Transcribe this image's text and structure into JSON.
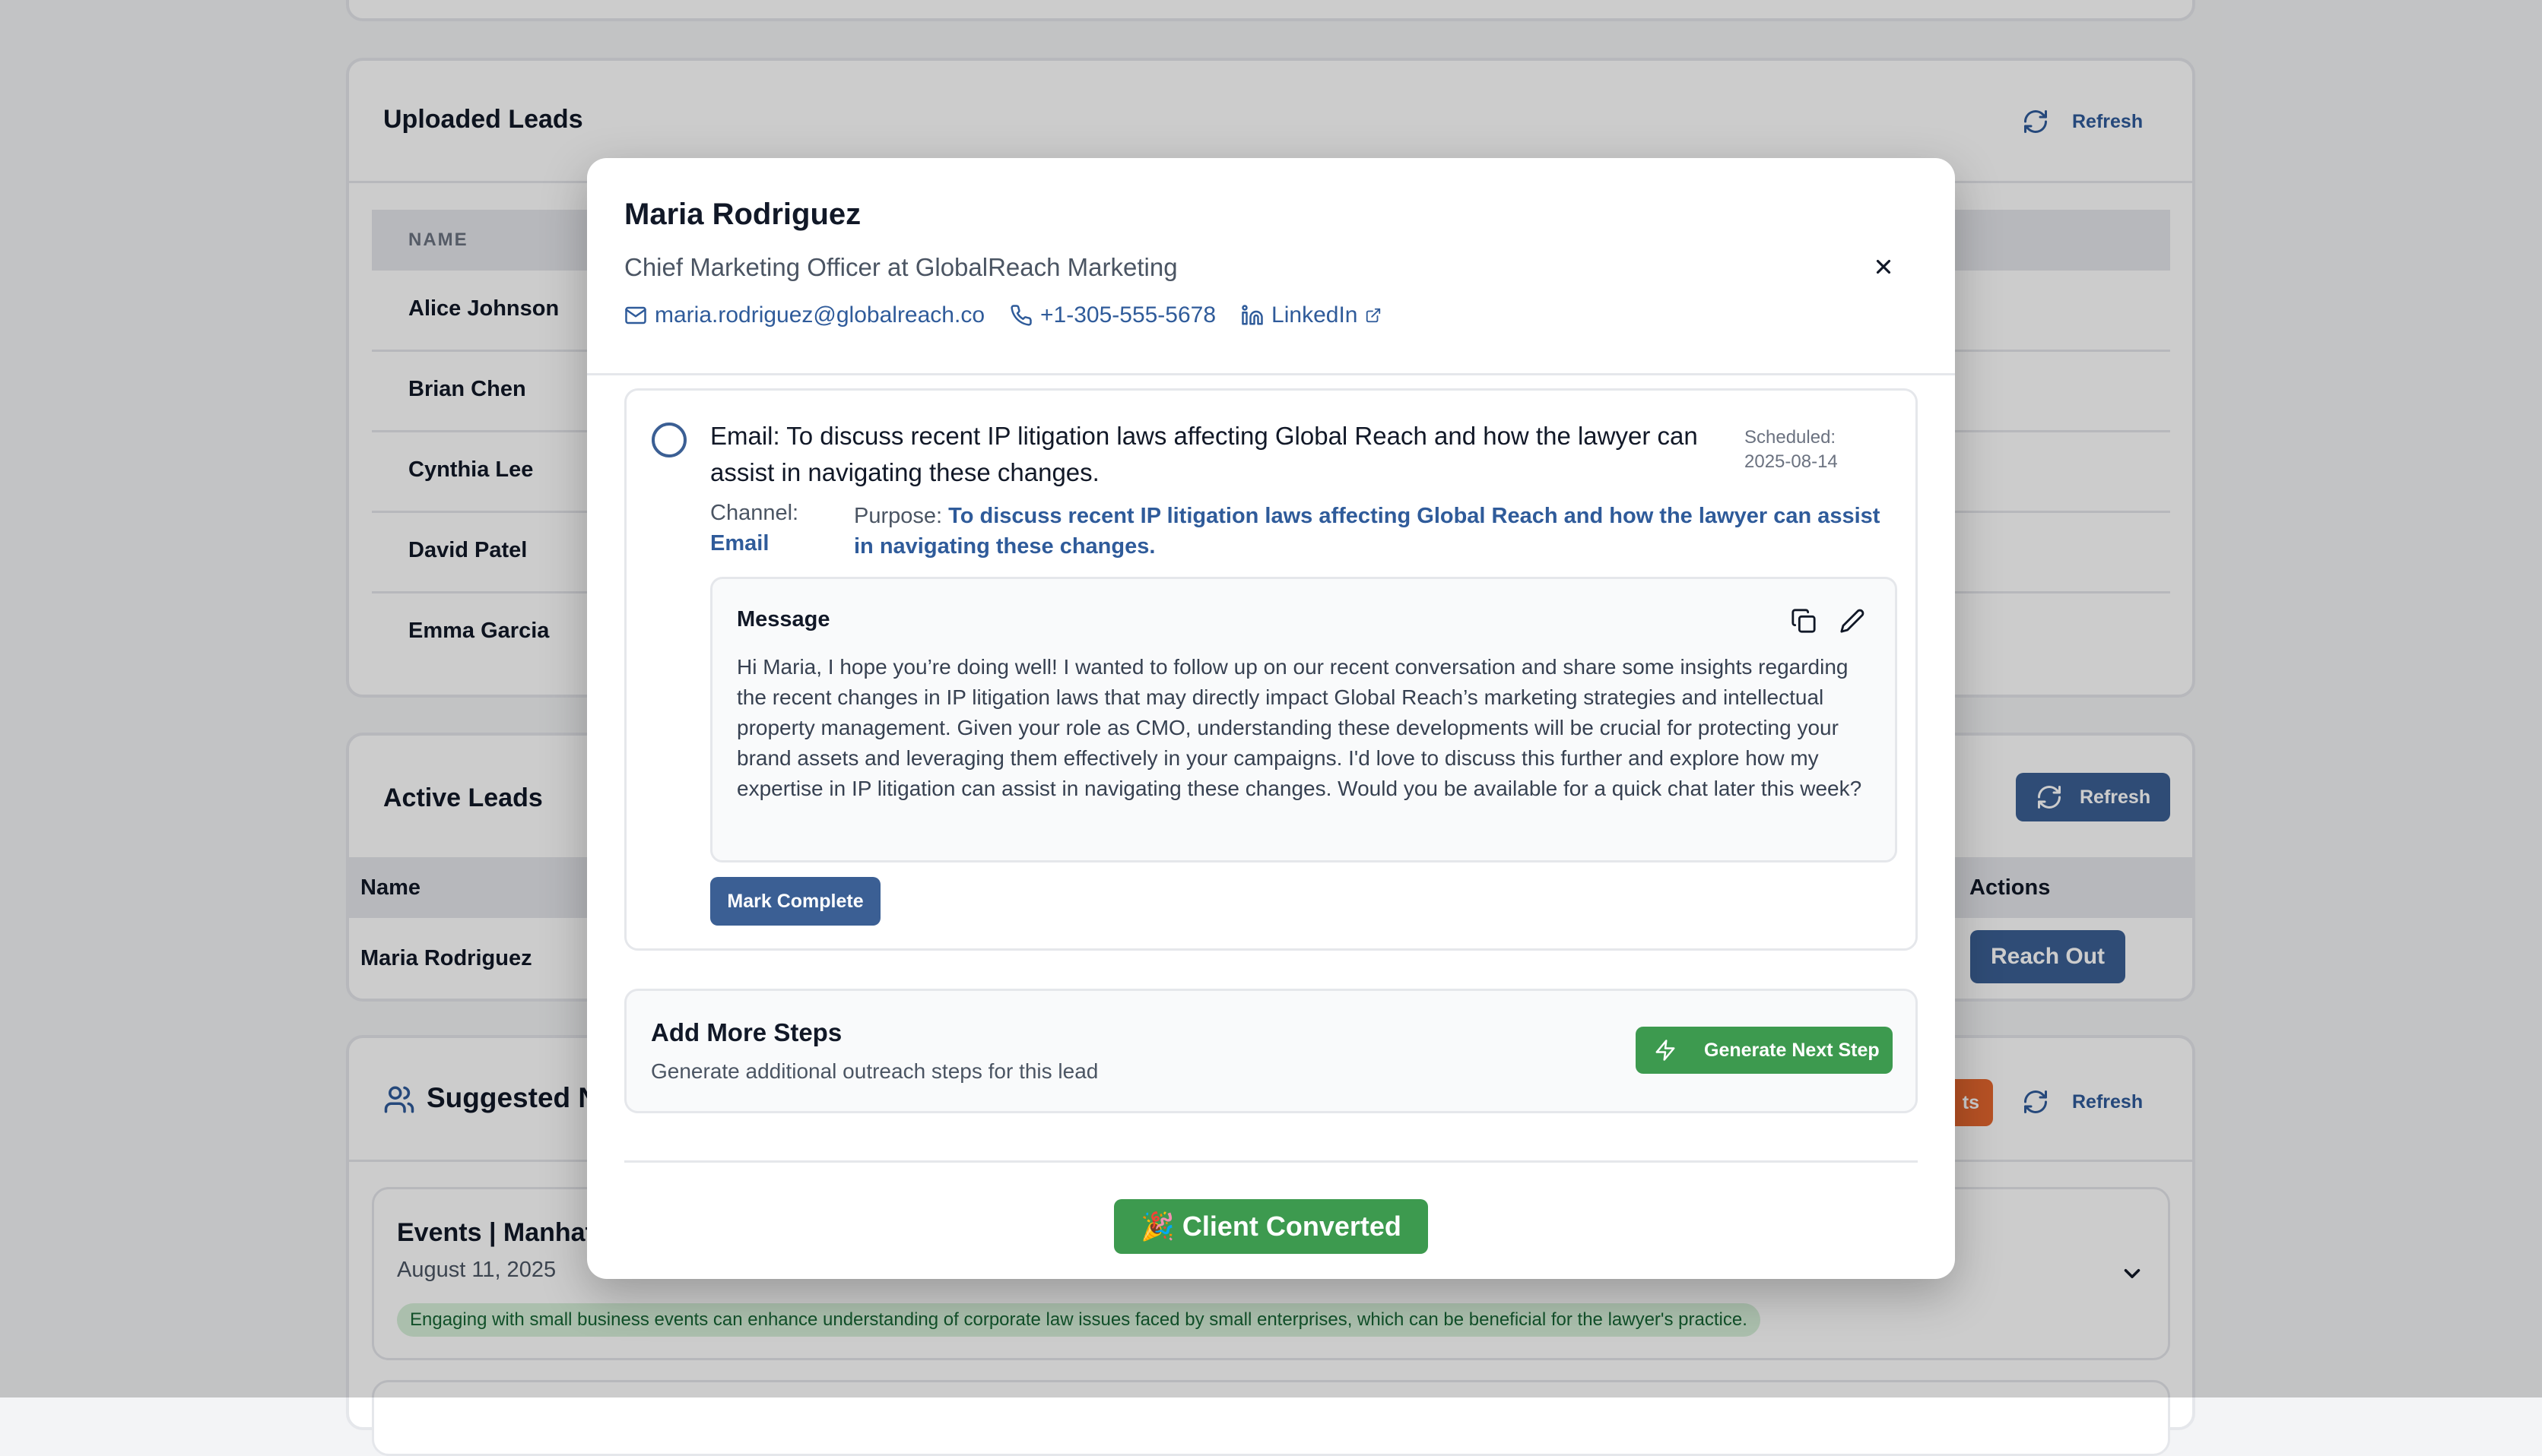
{
  "uploaded_leads": {
    "title": "Uploaded Leads",
    "refresh_label": "Refresh",
    "column_name": "NAME",
    "rows": [
      "Alice Johnson",
      "Brian Chen",
      "Cynthia Lee",
      "David Patel",
      "Emma Garcia"
    ]
  },
  "active_leads": {
    "title": "Active Leads",
    "refresh_label": "Refresh",
    "column_name": "Name",
    "column_actions": "Actions",
    "rows": [
      {
        "name": "Maria Rodriguez",
        "action": "Reach Out"
      }
    ]
  },
  "suggested": {
    "title_partial": "Suggested N",
    "badge_partial": "ts",
    "refresh_label": "Refresh",
    "event": {
      "title_partial": "Events | Manhat",
      "date": "August 11, 2025",
      "note": "Engaging with small business events can enhance understanding of corporate law issues faced by small enterprises, which can be beneficial for the lawyer's practice."
    }
  },
  "modal": {
    "name": "Maria Rodriguez",
    "subtitle": "Chief Marketing Officer at GlobalReach Marketing",
    "email": "maria.rodriguez@globalreach.co",
    "phone": "+1-305-555-5678",
    "linkedin": "LinkedIn",
    "step": {
      "title": "Email: To discuss recent IP litigation laws affecting Global Reach and how the lawyer can assist in navigating these changes.",
      "scheduled_label": "Scheduled:",
      "scheduled_date": "2025-08-14",
      "channel_label": "Channel:",
      "channel_value": "Email",
      "purpose_label": "Purpose:",
      "purpose_value": "To discuss recent IP litigation laws affecting Global Reach and how the lawyer can assist in navigating these changes.",
      "message_label": "Message",
      "message": "Hi Maria, I hope you’re doing well! I wanted to follow up on our recent conversation and share some insights regarding the recent changes in IP litigation laws that may directly impact Global Reach’s marketing strategies and intellectual property management. Given your role as CMO, understanding these developments will be crucial for protecting your brand assets and leveraging them effectively in your campaigns. I'd love to discuss this further and explore how my expertise in IP litigation can assist in navigating these changes. Would you be available for a quick chat later this week?",
      "mark_complete": "Mark Complete"
    },
    "add_more": {
      "title": "Add More Steps",
      "subtitle": "Generate additional outreach steps for this lead",
      "button": "Generate Next Step"
    },
    "client_converted": "🎉 Client Converted"
  },
  "colors": {
    "primary": "#3b5f94",
    "link": "#2f5b9a",
    "green": "#3d9a4f",
    "orange": "#e4662d",
    "note_bg": "#d6efd9"
  }
}
